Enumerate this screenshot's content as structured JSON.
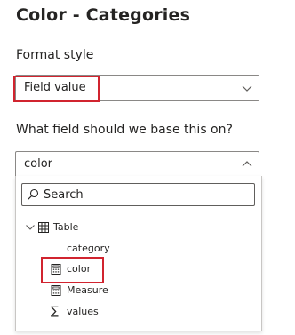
{
  "panel": {
    "title": "Color - Categories"
  },
  "format_style": {
    "label": "Format style",
    "value": "Field value",
    "chevron_icon": "chevron-down-icon"
  },
  "base_field": {
    "label": "What field should we base this on?",
    "value": "color",
    "chevron_icon": "chevron-up-icon"
  },
  "dropdown": {
    "search": {
      "placeholder": "Search",
      "icon": "search-icon"
    },
    "tree": {
      "table_label": "Table",
      "table_icon": "table-icon",
      "expand_icon": "chevron-down-icon",
      "items": [
        {
          "label": "category",
          "icon": "none"
        },
        {
          "label": "color",
          "icon": "calculator-icon"
        },
        {
          "label": "Measure",
          "icon": "calculator-icon"
        },
        {
          "label": "values",
          "icon": "sigma-icon"
        }
      ]
    }
  },
  "colors": {
    "highlight": "#d1242f",
    "border": "#8a8886",
    "text": "#252423"
  }
}
